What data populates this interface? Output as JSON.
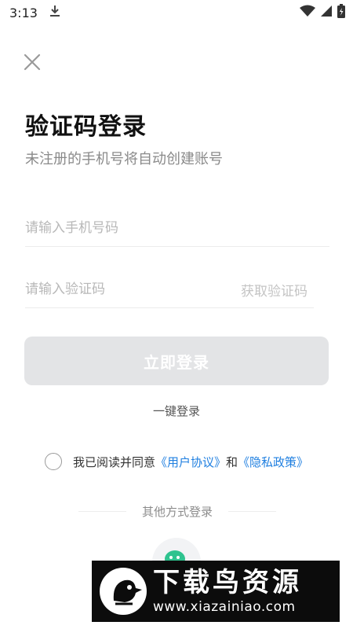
{
  "status_bar": {
    "time": "3:13",
    "icons": [
      "download-icon",
      "wifi-icon",
      "signal-icon",
      "battery-icon"
    ]
  },
  "close": {
    "icon": "close-icon"
  },
  "header": {
    "title": "验证码登录",
    "subtitle": "未注册的手机号将自动创建账号"
  },
  "form": {
    "phone_placeholder": "请输入手机号码",
    "code_placeholder": "请输入验证码",
    "get_code_label": "获取验证码",
    "login_label": "立即登录"
  },
  "one_key_login": "一键登录",
  "agreement": {
    "prefix": "我已阅读并同意",
    "user_agreement": "《用户协议》",
    "conjunction": "和",
    "privacy_policy": "《隐私政策》"
  },
  "other_login": {
    "label": "其他方式登录",
    "icon": "wechat-icon",
    "icon_color": "#2fc38f"
  },
  "watermark": {
    "brand": "下载鸟资源",
    "url": "www.xiazainiao.com"
  },
  "colors": {
    "link": "#1f7fe0",
    "button_disabled": "#e3e4e6"
  }
}
